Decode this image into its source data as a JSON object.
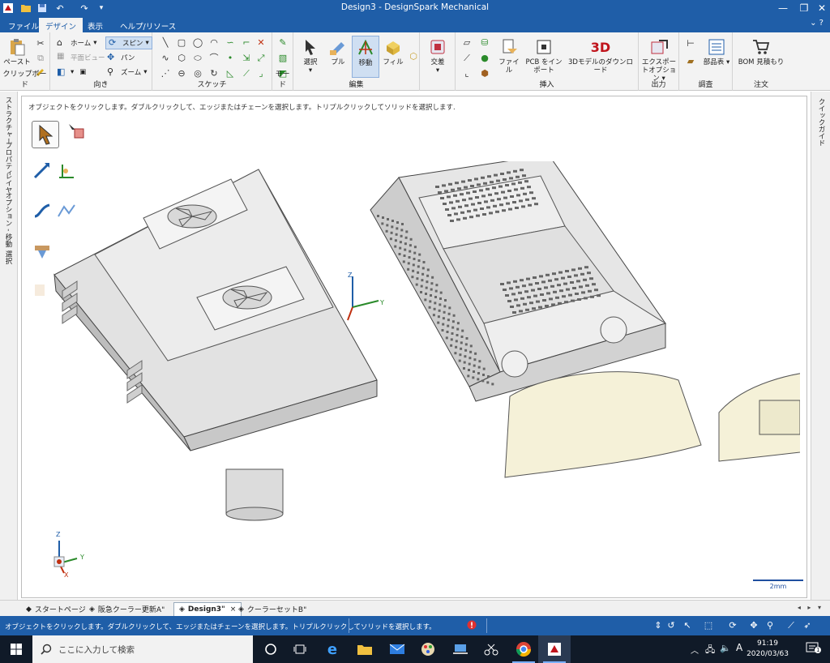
{
  "window": {
    "title": "Design3 - DesignSpark Mechanical",
    "controls": {
      "minimize": "—",
      "restore": "❐",
      "close": "✕"
    }
  },
  "quick_access": {
    "customize": "▾"
  },
  "ribbon_tabs": [
    {
      "label": "ファイル",
      "active": false
    },
    {
      "label": "デザイン",
      "active": true
    },
    {
      "label": "表示",
      "active": false
    },
    {
      "label": "ヘルプ/リソース",
      "active": false
    }
  ],
  "ribbon_right": "⌄ ?",
  "ribbon": {
    "clipboard": {
      "label": "クリップボード",
      "paste": "ペースト"
    },
    "orient": {
      "label": "向き",
      "home": "ホーム",
      "plan_view": "平面ビュー",
      "spin": "スピン",
      "pan": "パン",
      "zoom": "ズーム"
    },
    "sketch": {
      "label": "スケッチ"
    },
    "mode": {
      "label": "モード"
    },
    "edit": {
      "label": "編集",
      "select": "選択",
      "pull": "プル",
      "move": "移動",
      "fill": "フィル"
    },
    "intersect": {
      "label": "交差"
    },
    "insert": {
      "label": "挿入",
      "file": "ファイル",
      "pcb": "PCB をインポート",
      "model3d": "3Dモデルのダウンロード"
    },
    "output": {
      "label": "出力",
      "export": "エクスポートオプション"
    },
    "investigate": {
      "label": "調査",
      "parts": "部品表"
    },
    "order": {
      "label": "注文",
      "bom": "BOM 見積もり"
    }
  },
  "left_panel_tabs": [
    "ストラクチャー",
    "プロパティ",
    "レイヤ",
    "オプション - 移動",
    "選択"
  ],
  "right_panel_tabs": [
    "クイックガイド"
  ],
  "viewport": {
    "hint": "オブジェクトをクリックします。ダブルクリックして、エッジまたはチェーンを選択します。トリプルクリックしてソリッドを選択します.",
    "scale": "2mm",
    "axes": {
      "x": "X",
      "y": "Y",
      "z": "Z"
    }
  },
  "doc_tabs": [
    {
      "label": "スタートページ",
      "active": false,
      "closable": false
    },
    {
      "label": "阪急クーラー更新A\"",
      "active": false,
      "closable": false
    },
    {
      "label": "Design3\"",
      "active": true,
      "closable": true
    },
    {
      "label": "クーラーセットB\"",
      "active": false,
      "closable": false
    }
  ],
  "doc_tab_nav": "◂ ▸ ▾",
  "close_glyph": "×",
  "status": {
    "message": "オブジェクトをクリックします。ダブルクリックして、エッジまたはチェーンを選択します。トリプルクリックしてソリッドを選択します。"
  },
  "taskbar": {
    "search_placeholder": "ここに入力して検索",
    "time": "91:19",
    "date": "2020/03/63",
    "notification_count": "1",
    "ime": "A"
  },
  "colors": {
    "titlebar": "#1f5ea8",
    "ribbon_bg": "#f3f3f3",
    "taskbar": "#101a28",
    "model_gray": "#d9d9d9",
    "model_cream": "#f5f1d8"
  }
}
